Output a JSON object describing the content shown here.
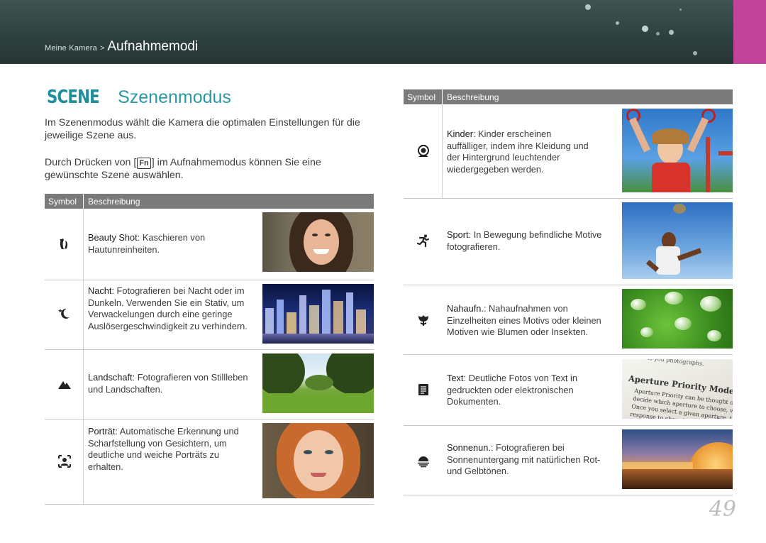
{
  "header": {
    "breadcrumb_parent": "Meine Kamera",
    "breadcrumb_sep": ">",
    "breadcrumb_current": "Aufnahmemodi",
    "accent_color": "#c0449a"
  },
  "section": {
    "badge": "SCENE",
    "title": "Szenenmodus",
    "intro1": "Im Szenenmodus wählt die Kamera die optimalen Einstellungen für die jeweilige Szene aus.",
    "intro2_before": "Durch Drücken von [",
    "intro2_key": "Fn",
    "intro2_after": "] im Aufnahmemodus können Sie eine gewünschte Szene auswählen."
  },
  "table_headers": {
    "symbol": "Symbol",
    "description": "Beschreibung"
  },
  "left_rows": [
    {
      "icon": "beauty-shot-icon",
      "name": "Beauty Shot",
      "text": ": Kaschieren von Hautunreinheiten."
    },
    {
      "icon": "night-icon",
      "name": "Nacht",
      "text": ": Fotografieren bei Nacht oder im Dunkeln. Verwenden Sie ein Stativ, um Verwackelungen durch eine geringe Auslösergeschwindigkeit zu verhindern."
    },
    {
      "icon": "landscape-icon",
      "name": "Landschaft",
      "text": ": Fotografieren von Stillleben und Landschaften."
    },
    {
      "icon": "portrait-icon",
      "name": "Porträt",
      "text": ": Automatische Erkennung und Scharfstellung von Gesichtern, um deutliche und weiche Porträts zu erhalten."
    }
  ],
  "right_rows": [
    {
      "icon": "children-icon",
      "name": "Kinder",
      "text": ": Kinder erscheinen auffälliger, indem ihre Kleidung und der Hintergrund leuchtender wiedergegeben werden."
    },
    {
      "icon": "sports-icon",
      "name": "Sport",
      "text": ": In Bewegung befindliche Motive fotografieren."
    },
    {
      "icon": "close-up-icon",
      "name": "Nahaufn.",
      "text": ": Nahaufnahmen von Einzelheiten eines Motivs oder kleinen Motiven wie Blumen oder Insekten."
    },
    {
      "icon": "text-icon",
      "name": "Text",
      "text": ": Deutliche Fotos von Text in gedruckten oder elektronischen Dokumenten."
    },
    {
      "icon": "sunset-icon",
      "name": "Sonnenun.",
      "text": ": Fotografieren bei Sonnenuntergang mit natürlichen Rot- und Gelbtönen."
    }
  ],
  "text_photo": {
    "top_line": "is you photographs.",
    "heading": "Aperture Priority Mode",
    "line1": "Aperture Priority can be thought of",
    "line2": "decide which aperture to choose, wh",
    "line3": "Once you select a given aperture, t",
    "line4": "response to changing"
  },
  "page_number": "49"
}
